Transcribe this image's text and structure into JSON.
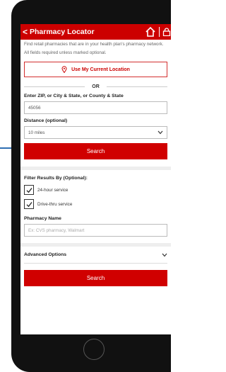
{
  "header": {
    "back_glyph": "<",
    "title": "Pharmacy Locator",
    "home_icon": "home-icon",
    "right_icon": "lock-icon"
  },
  "intro_text": "Find retail pharmacies that are in your health plan's pharmacy network.",
  "required_note": "All fields required unless marked optional.",
  "location_button": {
    "icon": "map-pin-icon",
    "label": "Use My Current Location"
  },
  "or_label": "OR",
  "address": {
    "label": "Enter ZIP, or City & State, or County & State",
    "value": "45056"
  },
  "distance": {
    "label": "Distance (optional)",
    "value": "10 miles"
  },
  "search_label": "Search",
  "filters": {
    "label": "Filter Results By (Optional):",
    "options": [
      {
        "label": "24-hour service",
        "checked": true
      },
      {
        "label": "Drive-thru service",
        "checked": true
      }
    ]
  },
  "pharmacy_name": {
    "label": "Pharmacy Name",
    "placeholder": "Ex: CVS pharmacy, Walmart"
  },
  "advanced_label": "Advanced Options",
  "search_label_2": "Search",
  "colors": {
    "brand_red": "#cc0000",
    "button_red": "#d00000",
    "accent_blue": "#2f6fb3"
  }
}
